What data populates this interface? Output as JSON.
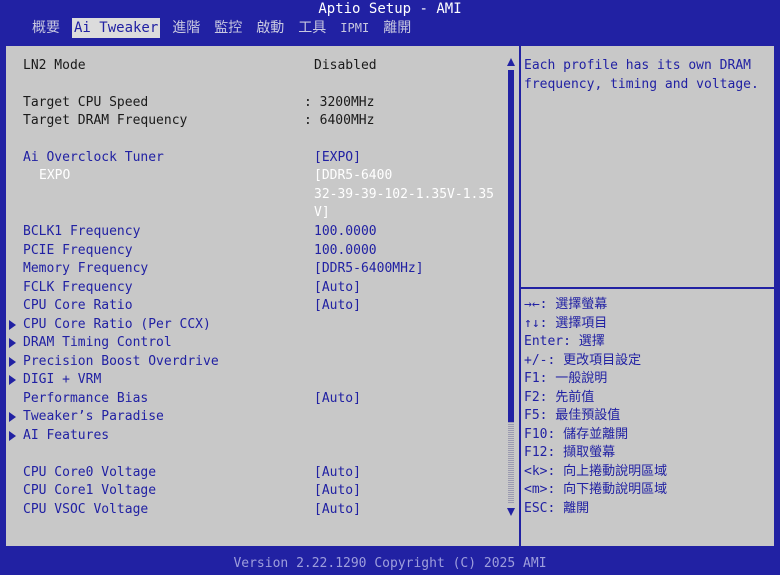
{
  "title": "Aptio Setup - AMI",
  "tabs": [
    {
      "label": "概要"
    },
    {
      "label": "Ai Tweaker"
    },
    {
      "label": "進階"
    },
    {
      "label": "監控"
    },
    {
      "label": "啟動"
    },
    {
      "label": "工具"
    },
    {
      "label": "IPMI"
    },
    {
      "label": "離開"
    }
  ],
  "settings": {
    "ln2_mode": {
      "label": "LN2 Mode",
      "value": "Disabled"
    },
    "target_cpu_speed": {
      "label": "Target CPU Speed",
      "value": ": 3200MHz"
    },
    "target_dram_freq": {
      "label": "Target DRAM Frequency",
      "value": ": 6400MHz"
    },
    "ai_overclock_tuner": {
      "label": "Ai Overclock Tuner",
      "value": "[EXPO]"
    },
    "expo": {
      "label": "EXPO",
      "value_line1": "[DDR5-6400",
      "value_line2": "32-39-39-102-1.35V-1.35",
      "value_line3": "V]"
    },
    "bclk1": {
      "label": "BCLK1 Frequency",
      "value": "100.0000"
    },
    "pcie_freq": {
      "label": "PCIE Frequency",
      "value": "100.0000"
    },
    "memory_freq": {
      "label": "Memory Frequency",
      "value": "[DDR5-6400MHz]"
    },
    "fclk_freq": {
      "label": "FCLK Frequency",
      "value": "[Auto]"
    },
    "cpu_core_ratio": {
      "label": "CPU Core Ratio",
      "value": "[Auto]"
    },
    "cpu_core_ratio_ccx": {
      "label": "CPU Core Ratio (Per CCX)"
    },
    "dram_timing": {
      "label": "DRAM Timing Control"
    },
    "pbo": {
      "label": "Precision Boost Overdrive"
    },
    "digi_vrm": {
      "label": "DIGI + VRM"
    },
    "perf_bias": {
      "label": "Performance Bias",
      "value": "[Auto]"
    },
    "tweakers_paradise": {
      "label": "Tweaker’s Paradise"
    },
    "ai_features": {
      "label": "AI Features"
    },
    "cpu_core0_voltage": {
      "label": "CPU Core0 Voltage",
      "value": "[Auto]"
    },
    "cpu_core1_voltage": {
      "label": "CPU Core1 Voltage",
      "value": "[Auto]"
    },
    "cpu_vsoc_voltage": {
      "label": "CPU VSOC Voltage",
      "value": "[Auto]"
    }
  },
  "help_text": "Each profile has its own DRAM frequency, timing and voltage.",
  "keys": [
    {
      "key": "→←",
      "desc": ": 選擇螢幕"
    },
    {
      "key": "↑↓",
      "desc": ": 選擇項目"
    },
    {
      "key": "Enter",
      "desc": ": 選擇"
    },
    {
      "key": "+/-",
      "desc": ": 更改項目設定"
    },
    {
      "key": "F1",
      "desc": ": 一般說明"
    },
    {
      "key": "F2",
      "desc": ": 先前值"
    },
    {
      "key": "F5",
      "desc": ": 最佳預設值"
    },
    {
      "key": "F10",
      "desc": ": 儲存並離開"
    },
    {
      "key": "F12",
      "desc": ": 擷取螢幕"
    },
    {
      "key": "<k>",
      "desc": ": 向上捲動說明區域"
    },
    {
      "key": "<m>",
      "desc": ": 向下捲動說明區域"
    },
    {
      "key": "ESC",
      "desc": ": 離開"
    }
  ],
  "scroll_position": 0,
  "footer": "Version 2.22.1290 Copyright (C) 2025 AMI",
  "colors": {
    "background": "#2121a3",
    "panel": "#c8c8c8",
    "accent": "#2121a3",
    "selected_text": "#ffffff"
  }
}
